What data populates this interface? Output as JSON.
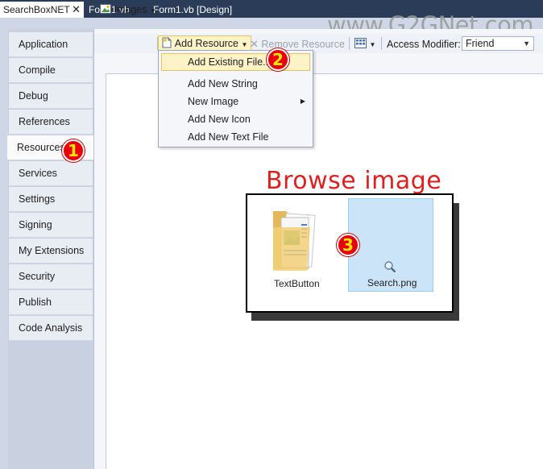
{
  "tabs": [
    {
      "label": "SearchBoxNET",
      "close": "✕"
    },
    {
      "label": "Form1.vb"
    },
    {
      "label": "Form1.vb [Design]"
    }
  ],
  "watermark": "www.G2GNet.com",
  "sidebar": {
    "items": [
      {
        "label": "Application"
      },
      {
        "label": "Compile"
      },
      {
        "label": "Debug"
      },
      {
        "label": "References"
      },
      {
        "label": "Resources"
      },
      {
        "label": "Services"
      },
      {
        "label": "Settings"
      },
      {
        "label": "Signing"
      },
      {
        "label": "My Extensions"
      },
      {
        "label": "Security"
      },
      {
        "label": "Publish"
      },
      {
        "label": "Code Analysis"
      }
    ],
    "active": "Resources"
  },
  "toolbar": {
    "images_label": "Images",
    "add_resource_label": "Add Resource",
    "remove_resource_label": "Remove Resource",
    "access_modifier_label": "Access Modifier:",
    "access_modifier_value": "Friend"
  },
  "add_resource_menu": {
    "items": [
      {
        "label": "Add Existing File..."
      },
      {
        "label": "Add New String"
      },
      {
        "label": "New Image"
      },
      {
        "label": "Add New Icon"
      },
      {
        "label": "Add New Text File"
      }
    ]
  },
  "browse": {
    "title": "Browse image",
    "files": [
      {
        "name": "TextButton",
        "icon": "folder-icon"
      },
      {
        "name": "Search.png",
        "icon": "image-file-icon"
      }
    ]
  },
  "badges": [
    "1",
    "2",
    "3"
  ],
  "colors": {
    "badge": "#e8000a",
    "badge_text": "#ffe600",
    "annotation_title": "#e02020",
    "tab_bar": "#2b3c59",
    "menu_highlight": "#fdf3c6",
    "selection": "#cce4f7"
  }
}
